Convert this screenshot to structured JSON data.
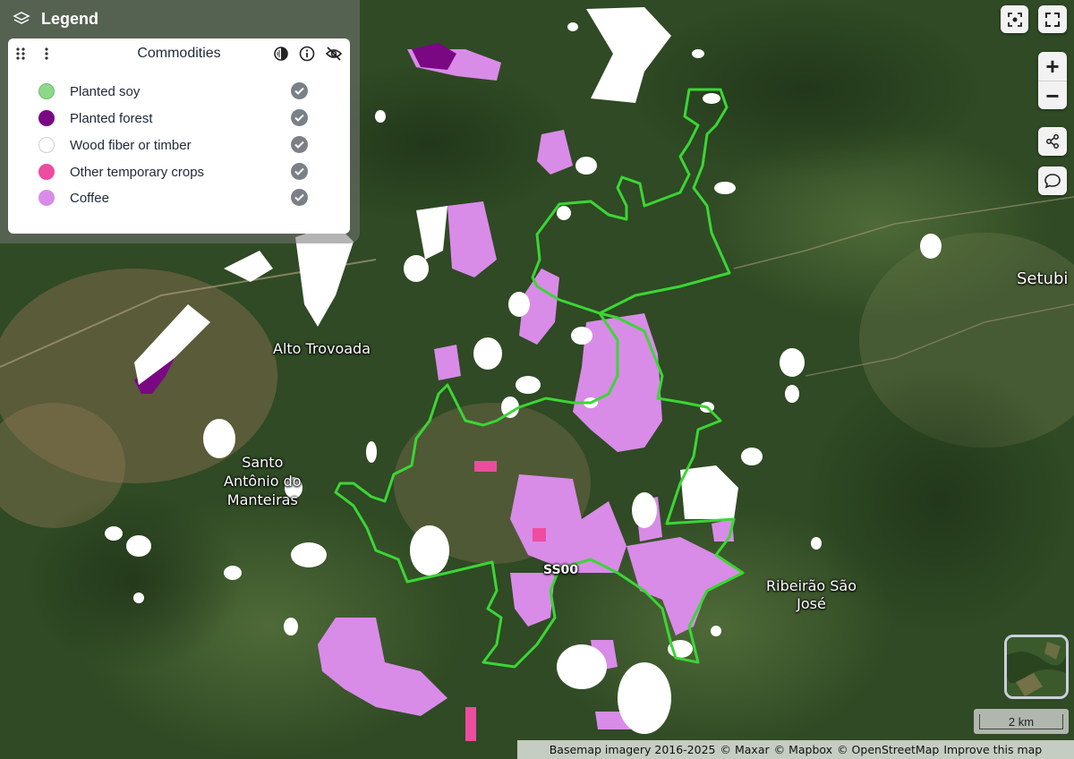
{
  "legend": {
    "title": "Legend",
    "card_title": "Commodities",
    "items": [
      {
        "label": "Planted soy",
        "color": "#8fd88a"
      },
      {
        "label": "Planted forest",
        "color": "#7a0883"
      },
      {
        "label": "Wood fiber or timber",
        "color": "#ffffff"
      },
      {
        "label": "Other temporary crops",
        "color": "#ee4c9f"
      },
      {
        "label": "Coffee",
        "color": "#d98be8"
      }
    ]
  },
  "places": [
    {
      "name": "Alto Trovoada"
    },
    {
      "name": "Santo\nAntônio do\nManteiras"
    },
    {
      "name": "SS00"
    },
    {
      "name": "Ribeirão São\nJosé"
    },
    {
      "name": "Setubi"
    }
  ],
  "colors": {
    "boundary": "#3bd635",
    "coffee": "#d98be8",
    "wood": "#ffffff",
    "forest": "#7a0883",
    "other_crops": "#ee4c9f",
    "terrain_dark": "#2c4421",
    "terrain_light": "#4f6a35"
  },
  "controls": {
    "zoom_in": "+",
    "zoom_out": "−",
    "icons": [
      "recenter-icon",
      "fullscreen-icon",
      "share-icon",
      "comment-icon"
    ]
  },
  "scale": {
    "label": "2 km"
  },
  "attribution": {
    "basemap": "Basemap imagery 2016-2025",
    "maxar": "© Maxar",
    "mapbox": "© Mapbox",
    "osm": "© OpenStreetMap",
    "improve": "Improve this map"
  }
}
